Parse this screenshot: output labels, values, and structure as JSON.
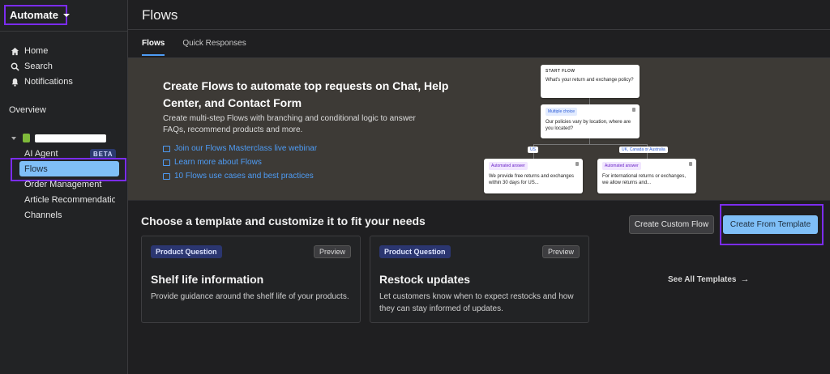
{
  "app": {
    "name": "Automate"
  },
  "sidebar": {
    "nav": [
      {
        "label": "Home",
        "icon": "home-icon"
      },
      {
        "label": "Search",
        "icon": "search-icon"
      },
      {
        "label": "Notifications",
        "icon": "bell-icon"
      }
    ],
    "overview_label": "Overview",
    "store_items": [
      {
        "label": "AI Agent",
        "badge": "BETA"
      },
      {
        "label": "Flows"
      },
      {
        "label": "Order Management"
      },
      {
        "label": "Article Recommendatior"
      },
      {
        "label": "Channels"
      }
    ]
  },
  "header": {
    "title": "Flows"
  },
  "tabs": [
    {
      "label": "Flows",
      "active": true
    },
    {
      "label": "Quick Responses",
      "active": false
    }
  ],
  "banner": {
    "title": "Create Flows to automate top requests on Chat, Help Center, and Contact Form",
    "description": "Create multi-step Flows with branching and conditional logic to answer FAQs, recommend products and more.",
    "links": [
      "Join our Flows Masterclass live webinar",
      "Learn more about Flows",
      "10 Flows use cases and best practices"
    ],
    "diagram": {
      "start_label": "START FLOW",
      "start_text": "What's your return and exchange policy?",
      "choice_tag": "Multiple choice",
      "choice_text": "Our policies vary by location, where are you located?",
      "branch_left": "US",
      "branch_right": "UK, Canada or Australia",
      "answer_tag": "Automated answer",
      "answer_left": "We provide free returns and exchanges within 30 days for US...",
      "answer_right": "For international returns or exchanges, we allow returns and..."
    }
  },
  "templates": {
    "section_title": "Choose a template and customize it to fit your needs",
    "create_custom_label": "Create Custom Flow",
    "create_template_label": "Create From Template",
    "see_all_label": "See All Templates",
    "cards": [
      {
        "tag": "Product Question",
        "preview": "Preview",
        "name": "Shelf life information",
        "description": "Provide guidance around the shelf life of your products."
      },
      {
        "tag": "Product Question",
        "preview": "Preview",
        "name": "Restock updates",
        "description": "Let customers know when to expect restocks and how they can stay informed of updates."
      }
    ]
  },
  "colors": {
    "accent": "#4e9cf5",
    "primary_button": "#7fbff7",
    "highlight": "#7b2cf0"
  }
}
